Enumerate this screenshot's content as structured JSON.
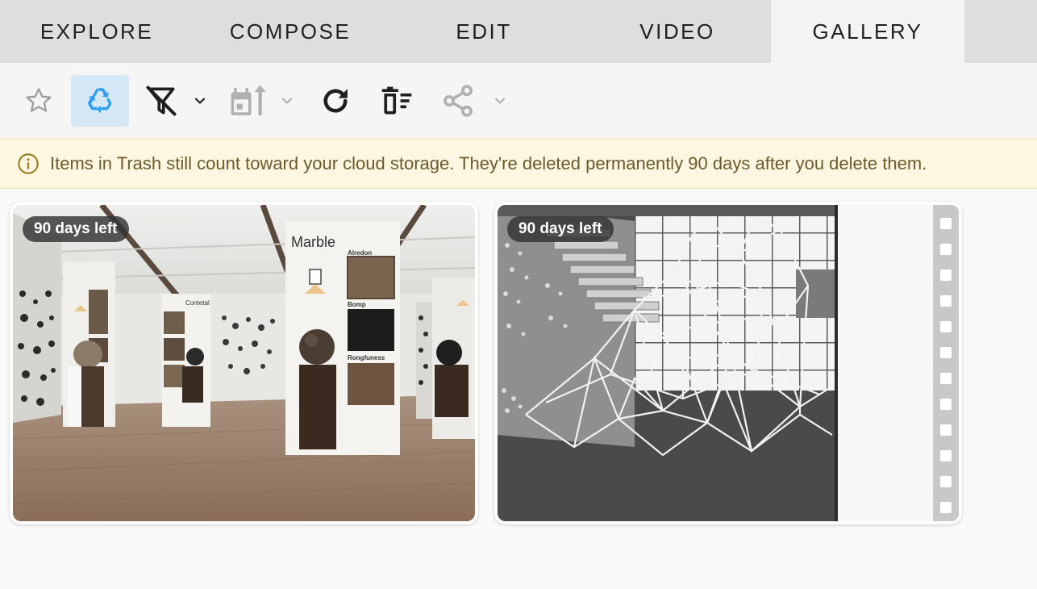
{
  "tabs": [
    {
      "label": "EXPLORE"
    },
    {
      "label": "COMPOSE"
    },
    {
      "label": "EDIT"
    },
    {
      "label": "VIDEO"
    },
    {
      "label": "GALLERY",
      "active": true
    }
  ],
  "toolbar": {
    "buttons": [
      {
        "icon": "star-outline-icon"
      },
      {
        "icon": "recycle-icon",
        "active": true
      },
      {
        "icon": "filter-off-icon"
      },
      {
        "icon": "calendar-sort-icon"
      },
      {
        "icon": "refresh-icon"
      },
      {
        "icon": "delete-sweep-icon"
      },
      {
        "icon": "share-icon"
      }
    ]
  },
  "banner": {
    "icon": "info-icon",
    "message": "Items in Trash still count toward your cloud storage. They're deleted permanently 90 days after you delete them."
  },
  "gallery": {
    "items": [
      {
        "badge": "90 days left",
        "sign_title": "Marble",
        "panel_labels": [
          "Alredon",
          "Bomp",
          "Rongfuness"
        ],
        "small_label": "Contetal"
      },
      {
        "badge": "90 days left"
      }
    ]
  },
  "colors": {
    "tab_bg": "#dedede",
    "tab_active_bg": "#f3f3f3",
    "toolbar_bg": "#f5f5f5",
    "active_button_bg": "#d6e8f5",
    "accent_blue": "#2a9df4",
    "banner_bg": "#fdf6e0",
    "banner_text": "#6b5b2c"
  }
}
